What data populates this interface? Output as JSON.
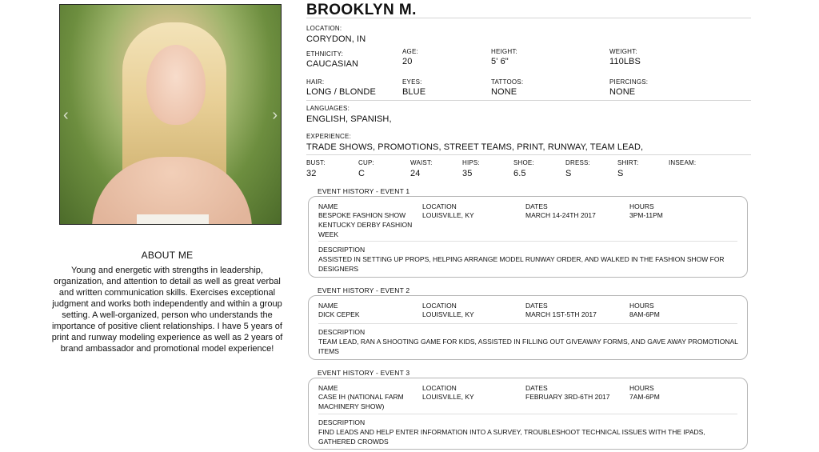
{
  "profile": {
    "name": "BROOKLYN M.",
    "location_label": "LOCATION:",
    "location": "CORYDON, IN",
    "ethnicity_label": "ETHNICITY:",
    "ethnicity": "CAUCASIAN",
    "age_label": "AGE:",
    "age": "20",
    "height_label": "HEIGHT:",
    "height": "5' 6\"",
    "weight_label": "WEIGHT:",
    "weight": "110LBS",
    "hair_label": "HAIR:",
    "hair": "LONG / BLONDE",
    "eyes_label": "EYES:",
    "eyes": "BLUE",
    "tattoos_label": "TATTOOS:",
    "tattoos": "NONE",
    "piercings_label": "PIERCINGS:",
    "piercings": "NONE",
    "languages_label": "LANGUAGES:",
    "languages": "ENGLISH, SPANISH,",
    "experience_label": "EXPERIENCE:",
    "experience": "TRADE SHOWS, PROMOTIONS, STREET TEAMS, PRINT, RUNWAY, TEAM LEAD,"
  },
  "measurements": [
    {
      "label": "BUST:",
      "value": "32"
    },
    {
      "label": "CUP:",
      "value": "C"
    },
    {
      "label": "WAIST:",
      "value": "24"
    },
    {
      "label": "HIPS:",
      "value": "35"
    },
    {
      "label": "SHOE:",
      "value": "6.5"
    },
    {
      "label": "DRESS:",
      "value": "S"
    },
    {
      "label": "SHIRT:",
      "value": "S"
    },
    {
      "label": "INSEAM:",
      "value": ""
    }
  ],
  "about": {
    "title": "ABOUT ME",
    "text": "Young and energetic with strengths in leadership, organization, and attention to detail as well as great verbal and written communication skills. Exercises exceptional judgment and works both independently and within a group setting. A well-organized, person who understands the importance of positive client relationships. I have 5 years of print and runway modeling experience as well as 2 years of brand ambassador and promotional model experience!"
  },
  "carousel": {
    "prev_icon": "‹",
    "next_icon": "›"
  },
  "event_headers": {
    "name": "NAME",
    "location": "LOCATION",
    "dates": "DATES",
    "hours": "HOURS",
    "description": "DESCRIPTION"
  },
  "events": [
    {
      "title": "EVENT HISTORY - EVENT 1",
      "name": "BESPOKE FASHION SHOW KENTUCKY DERBY FASHION WEEK",
      "location": "LOUISVILLE, KY",
      "dates": "MARCH 14-24TH 2017",
      "hours": "3PM-11PM",
      "description": "ASSISTED IN SETTING UP PROPS, HELPING ARRANGE MODEL RUNWAY ORDER, AND WALKED IN THE FASHION SHOW FOR DESIGNERS"
    },
    {
      "title": "EVENT HISTORY - EVENT 2",
      "name": "DICK CEPEK",
      "location": "LOUISVILLE, KY",
      "dates": "MARCH 1ST-5TH 2017",
      "hours": "8AM-6PM",
      "description": "TEAM LEAD, RAN A SHOOTING GAME FOR KIDS, ASSISTED IN FILLING OUT GIVEAWAY FORMS, AND GAVE AWAY PROMOTIONAL ITEMS"
    },
    {
      "title": "EVENT HISTORY - EVENT 3",
      "name": "CASE IH (NATIONAL FARM MACHINERY SHOW)",
      "location": "LOUISVILLE, KY",
      "dates": "FEBRUARY 3RD-6TH 2017",
      "hours": "7AM-6PM",
      "description": "FIND LEADS AND HELP ENTER INFORMATION INTO A SURVEY, TROUBLESHOOT TECHNICAL ISSUES WITH THE IPADS, GATHERED CROWDS"
    }
  ]
}
